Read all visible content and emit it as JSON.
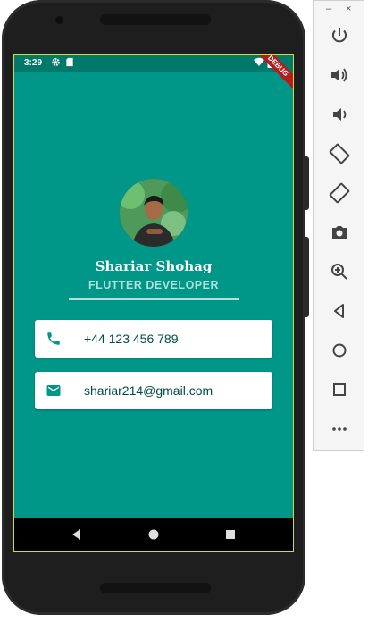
{
  "status_bar": {
    "time": "3:29",
    "debug_banner": "DEBUG"
  },
  "profile": {
    "name": "Shariar Shohag",
    "title": "FLUTTER DEVELOPER",
    "phone": "+44 123 456 789",
    "email": "shariar214@gmail.com"
  },
  "colors": {
    "background": "#009688",
    "status_bar": "#00796b",
    "accent_text": "#004d40",
    "subtitle": "#b2dfdb"
  },
  "icons": {
    "phone": "phone-icon",
    "email": "email-icon",
    "status": [
      "gear-icon",
      "sd-card-icon",
      "wifi-icon",
      "battery-icon"
    ],
    "nav": [
      "back-icon",
      "home-icon",
      "recents-icon"
    ],
    "emulator": [
      "power-icon",
      "volume-up-icon",
      "volume-down-icon",
      "rotate-left-icon",
      "rotate-right-icon",
      "camera-icon",
      "zoom-icon",
      "back-icon",
      "home-icon",
      "overview-icon",
      "more-icon"
    ]
  },
  "emulator_window": {
    "minimize": "–",
    "close": "×"
  }
}
